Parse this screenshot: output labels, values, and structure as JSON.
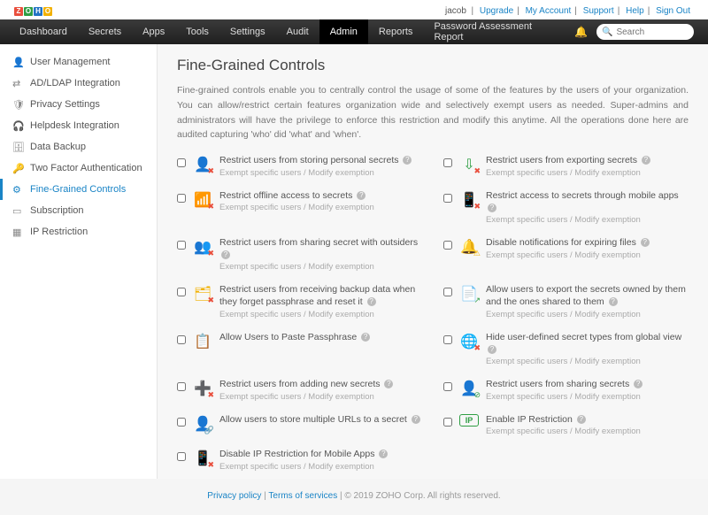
{
  "top": {
    "user": "jacob",
    "links": [
      "Upgrade",
      "My Account",
      "Support",
      "Help",
      "Sign Out"
    ]
  },
  "nav": {
    "tabs": [
      "Dashboard",
      "Secrets",
      "Apps",
      "Tools",
      "Settings",
      "Audit",
      "Admin",
      "Reports",
      "Password Assessment Report"
    ],
    "search_placeholder": "Search"
  },
  "sidebar": {
    "items": [
      "User Management",
      "AD/LDAP Integration",
      "Privacy Settings",
      "Helpdesk Integration",
      "Data Backup",
      "Two Factor Authentication",
      "Fine-Grained Controls",
      "Subscription",
      "IP Restriction"
    ]
  },
  "page": {
    "title": "Fine-Grained Controls",
    "desc": "Fine-grained controls enable you to centrally control the usage of some of the features by the users of your organization. You can allow/restrict certain features organization wide and selectively exempt users as needed. Super-admins and administrators will have the privilege to enforce this restriction and modify this anytime. All the operations done here are audited capturing 'who' did 'what' and 'when'."
  },
  "sub": "Exempt specific users / Modify exemption",
  "controls": {
    "c0": "Restrict users from storing personal secrets",
    "c1": "Restrict users from exporting secrets",
    "c2": "Restrict offline access to secrets",
    "c3": "Restrict access to secrets through mobile apps",
    "c4": "Restrict users from sharing secret with outsiders",
    "c5": "Disable notifications for expiring files",
    "c6": "Restrict users from receiving backup data when they forget passphrase and reset it",
    "c7": "Allow users to export the secrets owned by them and the ones shared to them",
    "c8": "Allow Users to Paste Passphrase",
    "c9": "Hide user-defined secret types from global view",
    "c10": "Restrict users from adding new secrets",
    "c11": "Restrict users from sharing secrets",
    "c12": "Allow users to store multiple URLs to a secret",
    "c13": "Enable IP Restriction",
    "c14": "Disable IP Restriction for Mobile Apps"
  },
  "footer": {
    "privacy": "Privacy policy",
    "terms": "Terms of services",
    "copy": " | © 2019  ZOHO Corp. All rights reserved."
  }
}
